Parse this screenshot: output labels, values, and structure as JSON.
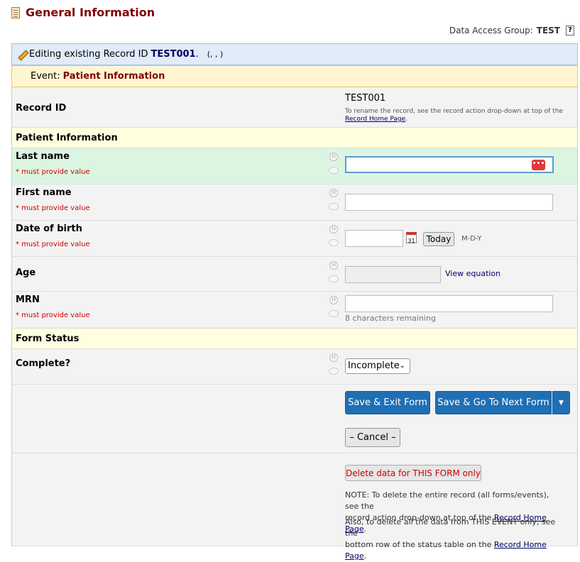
{
  "header": {
    "title": "General Information"
  },
  "dag": {
    "label": "Data Access Group:",
    "value": "TEST",
    "help": "?"
  },
  "edit_bar": {
    "prefix": "Editing existing Record ID",
    "record_id": "TEST001",
    "period": ".",
    "extra": "(, , )"
  },
  "event_bar": {
    "prefix": "Event:",
    "name": "Patient Information"
  },
  "record": {
    "label": "Record ID",
    "value": "TEST001",
    "note": "To rename the record, see the record action drop-down at top of the",
    "note_link": "Record Home Page",
    "note_end": "."
  },
  "sections": {
    "patient": "Patient Information",
    "status": "Form Status"
  },
  "fields": {
    "last_name": {
      "label": "Last name",
      "required": "* must provide value",
      "value": ""
    },
    "first_name": {
      "label": "First name",
      "required": "* must provide value",
      "value": ""
    },
    "dob": {
      "label": "Date of birth",
      "required": "* must provide value",
      "value": "",
      "today": "Today",
      "format": "M-D-Y"
    },
    "age": {
      "label": "Age",
      "link": "View equation"
    },
    "mrn": {
      "label": "MRN",
      "required": "* must provide value",
      "value": "",
      "remaining": "8 characters remaining"
    },
    "complete": {
      "label": "Complete?",
      "selected": "Incomplete"
    }
  },
  "field_icons": {
    "history": "H"
  },
  "buttons": {
    "save_exit": "Save & Exit Form",
    "save_next": "Save & Go To Next Form",
    "cancel": "– Cancel –",
    "delete": "Delete data for THIS FORM only"
  },
  "notes": {
    "n1a": "NOTE: To delete the entire record (all forms/events), see the",
    "n1b": "record action drop-down at top of the",
    "n2a": "Also, to delete all the data from THIS EVENT only, see the",
    "n2b": "bottom row of the status table on the",
    "link": "Record Home Page",
    "dot": "."
  },
  "colors": {
    "title": "#800000",
    "button_blue": "#1f6fb5",
    "required": "#cc0000",
    "active_row": "#dcf5e1"
  }
}
